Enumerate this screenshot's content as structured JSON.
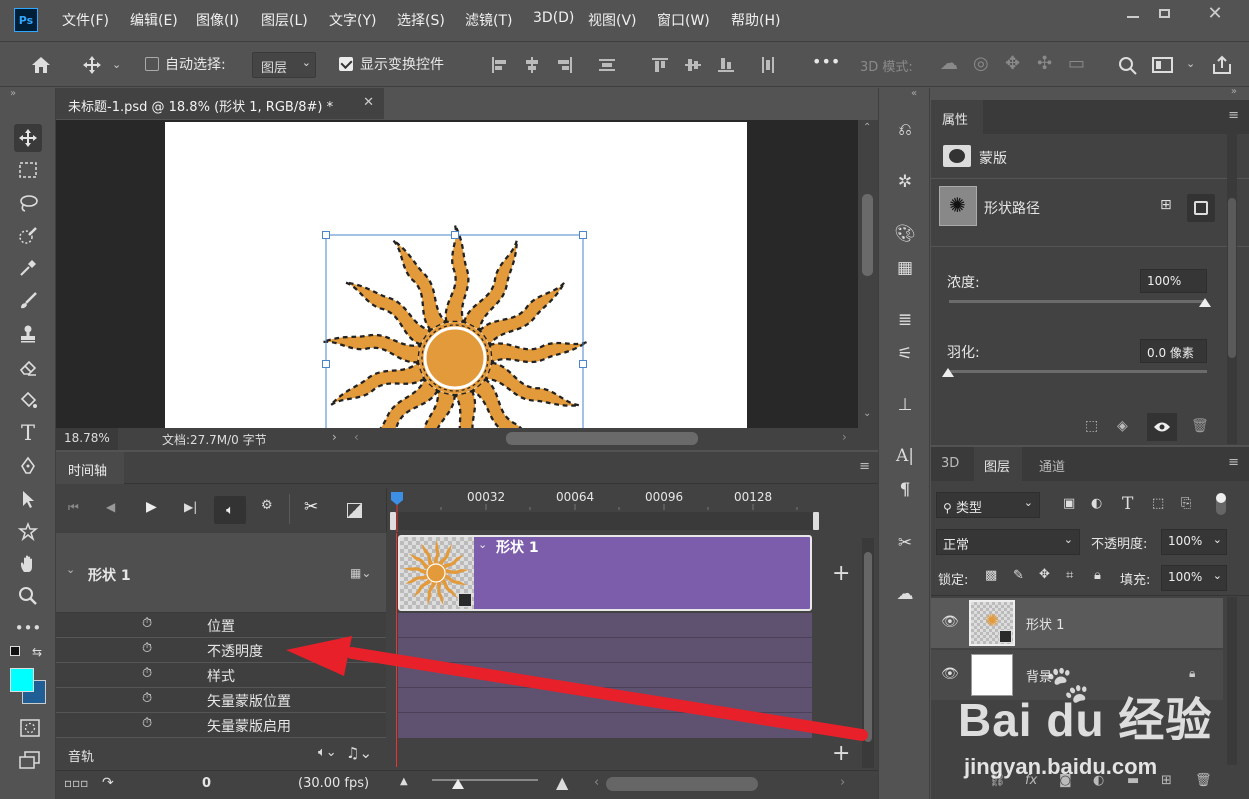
{
  "app": {
    "logo": "Ps"
  },
  "menu": [
    "文件(F)",
    "编辑(E)",
    "图像(I)",
    "图层(L)",
    "文字(Y)",
    "选择(S)",
    "滤镜(T)",
    "3D(D)",
    "视图(V)",
    "窗口(W)",
    "帮助(H)"
  ],
  "options": {
    "auto_select_label": "自动选择:",
    "auto_select_value": "图层",
    "show_transform_label": "显示变换控件",
    "mode_3d_label": "3D 模式:",
    "more": "•••"
  },
  "document": {
    "tab_title": "未标题-1.psd @ 18.8% (形状 1, RGB/8#) *",
    "zoom": "18.78%",
    "doc_info": "文档:27.7M/0 字节"
  },
  "timeline": {
    "panel_title": "时间轴",
    "ruler_ticks": [
      "00032",
      "00064",
      "00096",
      "00128"
    ],
    "layer_name": "形状 1",
    "clip_label": "形状 1",
    "properties": [
      "位置",
      "不透明度",
      "样式",
      "矢量蒙版位置",
      "矢量蒙版启用"
    ],
    "audio_label": "音轨",
    "current_frame": "0",
    "fps": "(30.00 fps)"
  },
  "properties_panel": {
    "tab": "属性",
    "mask_label": "蒙版",
    "shape_path_label": "形状路径",
    "density_label": "浓度:",
    "density_value": "100%",
    "feather_label": "羽化:",
    "feather_value": "0.0 像素"
  },
  "layers_panel": {
    "tabs": [
      "3D",
      "图层",
      "通道"
    ],
    "filter_label": "类型",
    "blend_mode": "正常",
    "opacity_label": "不透明度:",
    "opacity_value": "100%",
    "lock_label": "锁定:",
    "fill_label": "填充:",
    "fill_value": "100%",
    "layers": [
      {
        "name": "形状 1",
        "selected": true
      },
      {
        "name": "背景",
        "locked": true
      }
    ],
    "footer_fx": "fx"
  },
  "watermark": {
    "brand": "Bai du 经验",
    "url": "jingyan.baidu.com"
  },
  "colors": {
    "foreground": "#00ffff",
    "background": "#1f5f96",
    "clip": "#7b5dab",
    "arrow": "#e8202a",
    "sun": "#e39a3b"
  }
}
